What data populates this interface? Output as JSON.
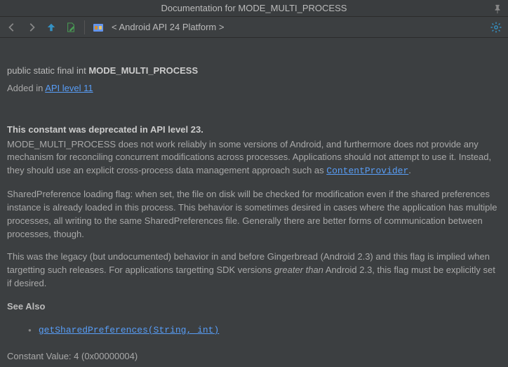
{
  "window": {
    "title": "Documentation for MODE_MULTI_PROCESS"
  },
  "toolbar": {
    "breadcrumb": "< Android API 24 Platform >"
  },
  "doc": {
    "signature_prefix": "public static final int ",
    "signature_name": "MODE_MULTI_PROCESS",
    "added_in_prefix": "Added in ",
    "added_in_link": "API level 11",
    "deprecated_heading": "This constant was deprecated in API level 23.",
    "deprecated_body_1": "MODE_MULTI_PROCESS does not work reliably in some versions of Android, and furthermore does not provide any mechanism for reconciling concurrent modifications across processes. Applications should not attempt to use it. Instead, they should use an explicit cross-process data management approach such as ",
    "deprecated_link": "ContentProvider",
    "deprecated_body_2": ".",
    "para2": "SharedPreference loading flag: when set, the file on disk will be checked for modification even if the shared preferences instance is already loaded in this process. This behavior is sometimes desired in cases where the application has multiple processes, all writing to the same SharedPreferences file. Generally there are better forms of communication between processes, though.",
    "para3_a": "This was the legacy (but undocumented) behavior in and before Gingerbread (Android 2.3) and this flag is implied when targetting such releases. For applications targetting SDK versions ",
    "para3_em": "greater than",
    "para3_b": " Android 2.3, this flag must be explicitly set if desired.",
    "see_also_heading": "See Also",
    "see_also_item": "getSharedPreferences(String, int)",
    "constant_value": "Constant Value: 4 (0x00000004)"
  }
}
